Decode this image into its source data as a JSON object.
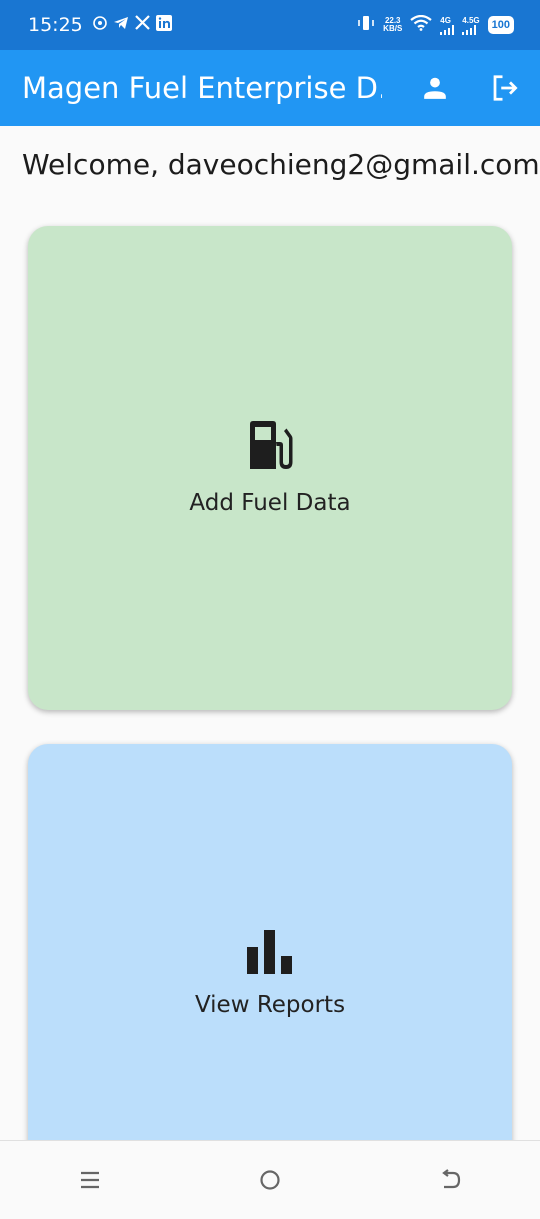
{
  "status_bar": {
    "time": "15:25",
    "net_speed_value": "22.3",
    "net_speed_unit": "KB/S",
    "net_type_1": "4G",
    "net_type_2": "4.5G",
    "battery": "100"
  },
  "app_bar": {
    "title": "Magen Fuel Enterprise D...",
    "profile_icon": "person-icon",
    "logout_icon": "logout-icon"
  },
  "welcome_text": "Welcome, daveochieng2@gmail.com",
  "cards": [
    {
      "label": "Add Fuel Data",
      "icon": "fuel-pump-icon",
      "color": "#c8e6c9"
    },
    {
      "label": "View Reports",
      "icon": "bar-chart-icon",
      "color": "#bbdefb"
    }
  ],
  "colors": {
    "app_bar": "#2196f3",
    "status_bar": "#1976d2"
  },
  "nav_bar": {
    "items": [
      "menu-icon",
      "home-icon",
      "back-icon"
    ]
  }
}
